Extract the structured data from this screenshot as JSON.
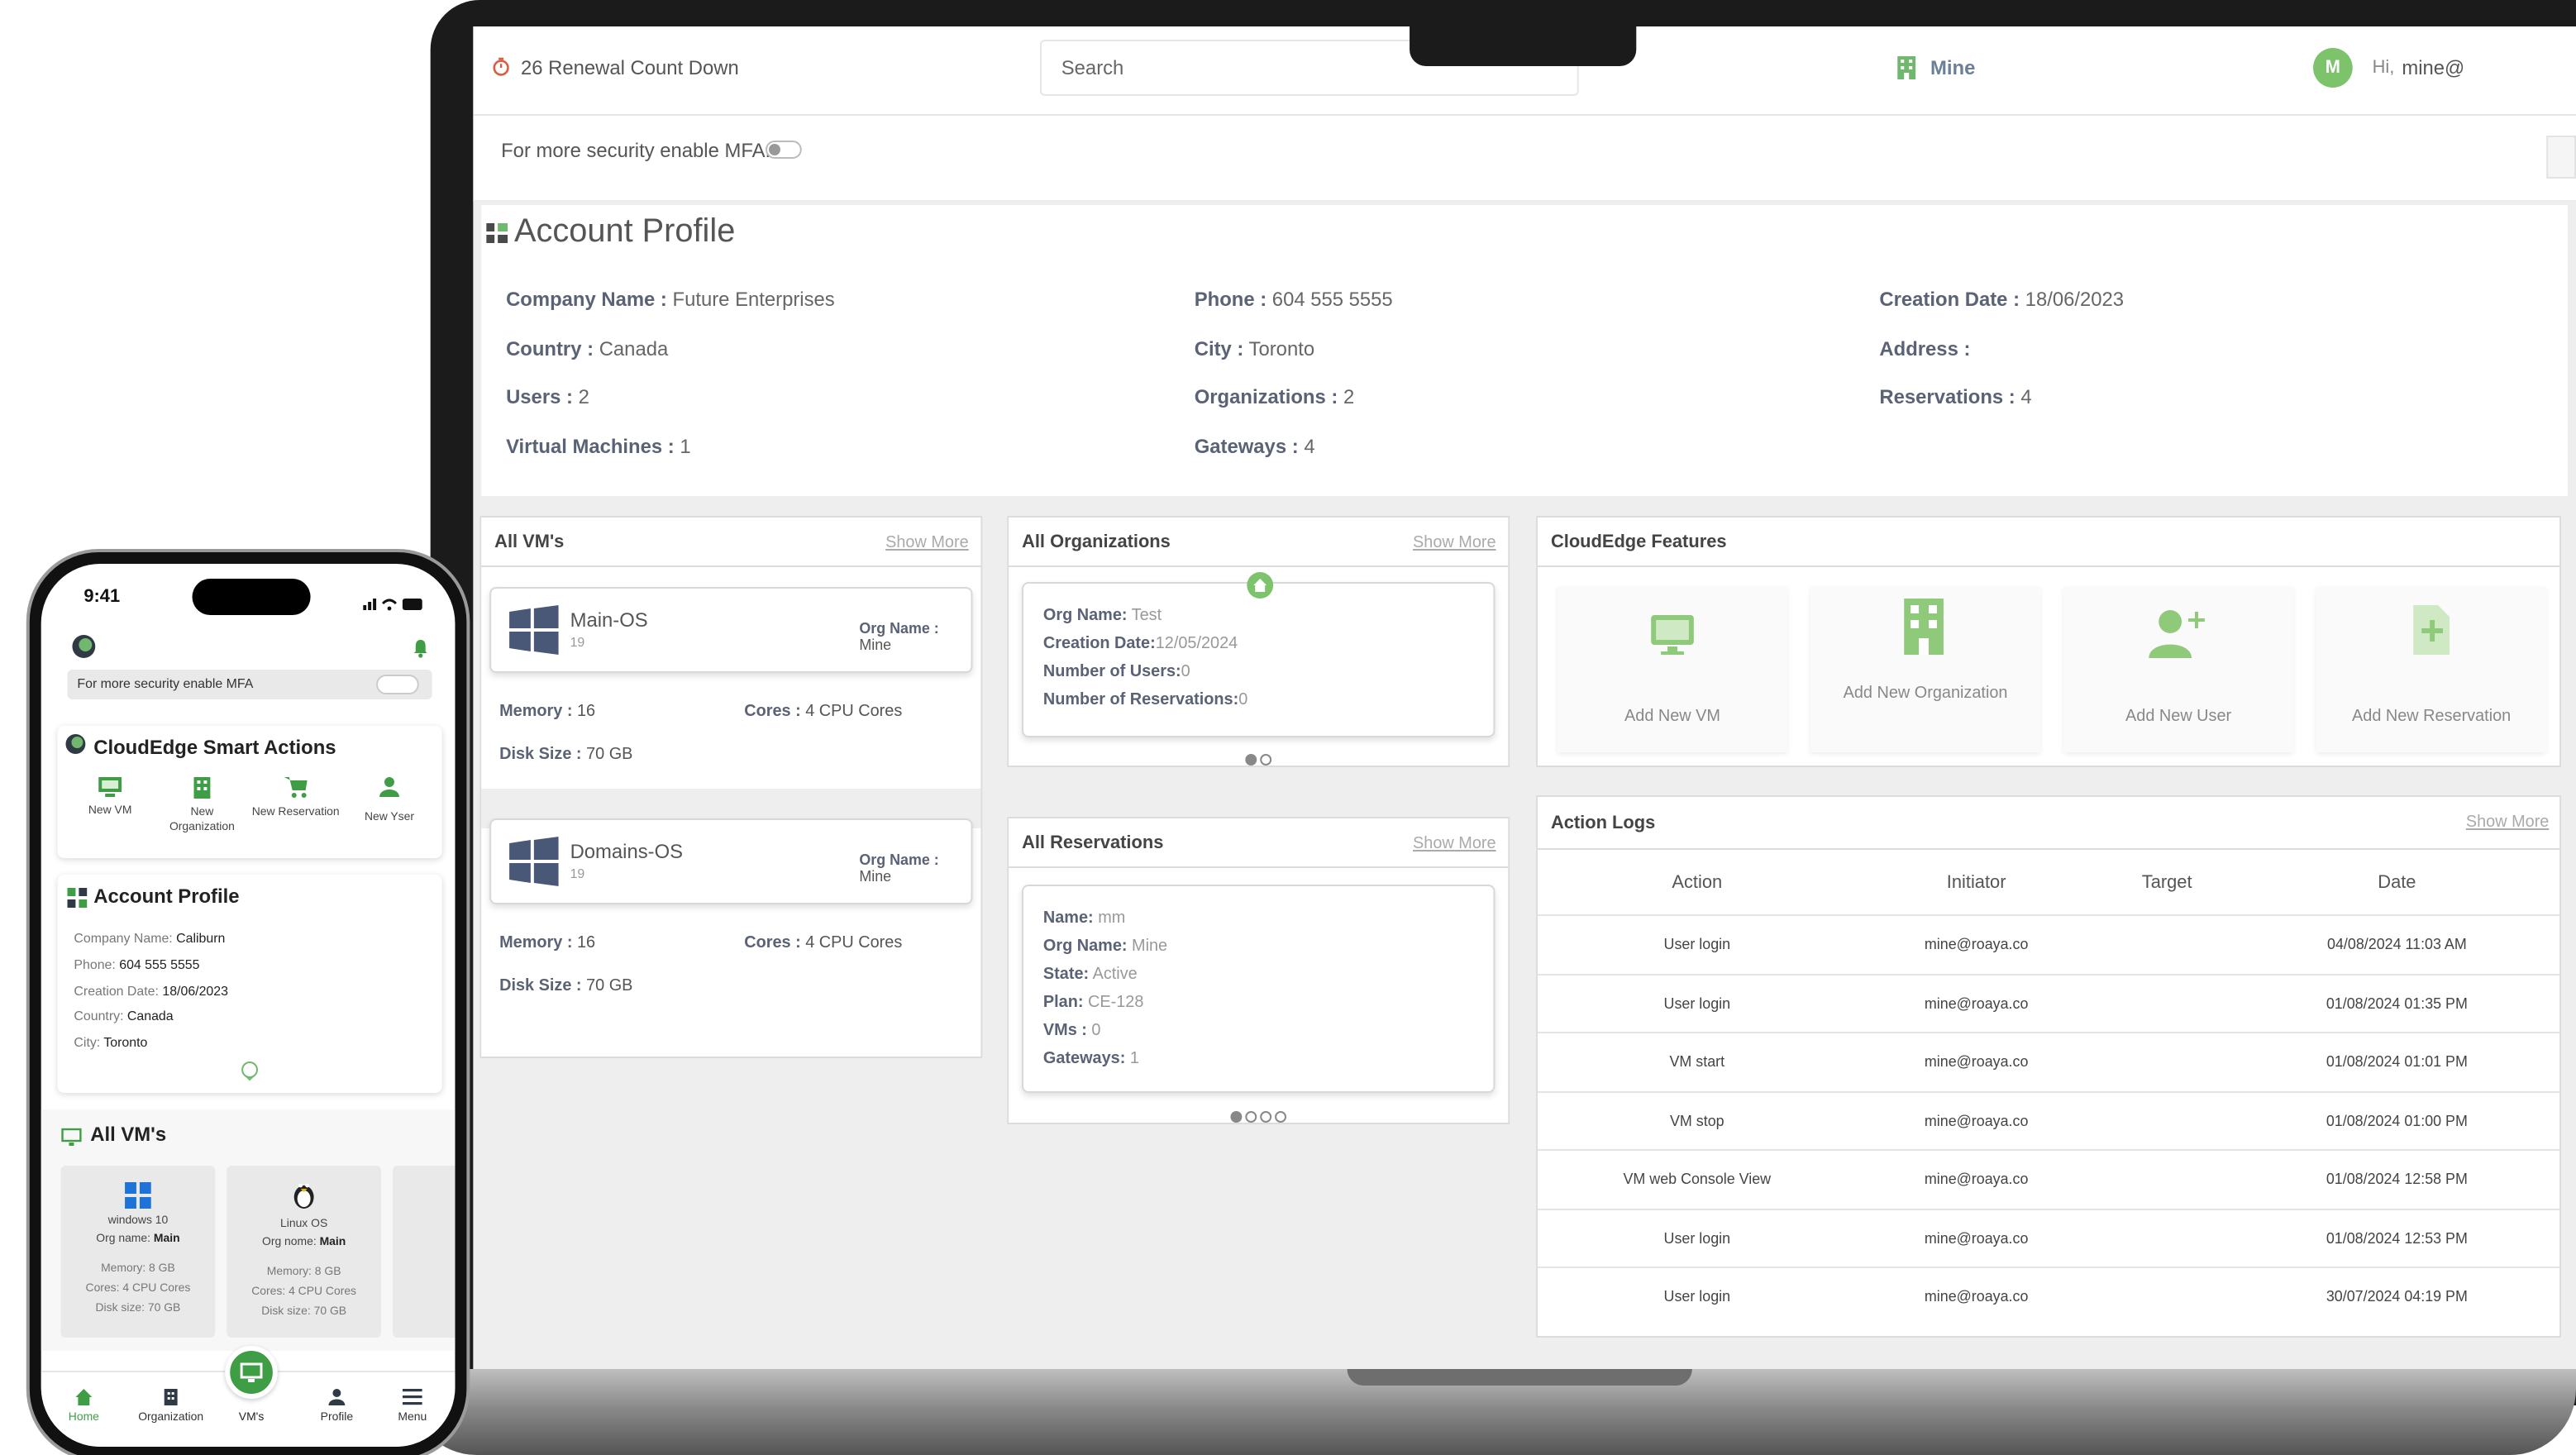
{
  "colors": {
    "brand_green": "#3f9d46",
    "accent_green": "#6fb86e",
    "frame": "#1b1b1b"
  },
  "laptop": {
    "topbar": {
      "renewal": "26 Renewal Count Down",
      "search_placeholder": "Search",
      "org": "Mine",
      "avatar_letter": "M",
      "greeting": "Hi,",
      "user": "mine@"
    },
    "mfa_label": "For more security enable MFA:",
    "profile": {
      "title": "Account Profile",
      "fields": [
        {
          "label": "Company Name :",
          "value": "Future Enterprises"
        },
        {
          "label": "Country :",
          "value": "Canada"
        },
        {
          "label": "Users :",
          "value": "2"
        },
        {
          "label": "Virtual Machines :",
          "value": "1"
        },
        {
          "label": "Phone :",
          "value": "604 555 5555"
        },
        {
          "label": "City :",
          "value": "Toronto"
        },
        {
          "label": "Organizations :",
          "value": "2"
        },
        {
          "label": "Gateways :",
          "value": "4"
        },
        {
          "label": "Creation Date :",
          "value": "18/06/2023"
        },
        {
          "label": "Address :",
          "value": ""
        },
        {
          "label": "Reservations :",
          "value": "4"
        }
      ]
    },
    "vms": {
      "title": "All VM's",
      "show_more": "Show More",
      "items": [
        {
          "name": "Main-OS",
          "sub": "19",
          "org_label": "Org Name :",
          "org": "Mine",
          "memory_label": "Memory :",
          "memory": "16",
          "cores_label": "Cores :",
          "cores": "4 CPU Cores",
          "disk_label": "Disk Size :",
          "disk": "70 GB"
        },
        {
          "name": "Domains-OS",
          "sub": "19",
          "org_label": "Org Name :",
          "org": "Mine",
          "memory_label": "Memory :",
          "memory": "16",
          "cores_label": "Cores :",
          "cores": "4 CPU Cores",
          "disk_label": "Disk Size :",
          "disk": "70 GB"
        }
      ]
    },
    "orgs": {
      "title": "All Organizations",
      "show_more": "Show More",
      "lines": [
        {
          "label": "Org Name:",
          "value": " Test"
        },
        {
          "label": "Creation Date:",
          "value": "12/05/2024"
        },
        {
          "label": "Number of Users:",
          "value": "0"
        },
        {
          "label": "Number of Reservations:",
          "value": "0"
        }
      ]
    },
    "reservations": {
      "title": "All Reservations",
      "show_more": "Show More",
      "lines": [
        {
          "label": "Name:",
          "value": " mm"
        },
        {
          "label": "Org Name:",
          "value": " Mine"
        },
        {
          "label": "State:",
          "value": " Active"
        },
        {
          "label": "Plan:",
          "value": " CE-128"
        },
        {
          "label": "VMs :",
          "value": " 0"
        },
        {
          "label": "Gateways:",
          "value": " 1"
        }
      ]
    },
    "features": {
      "title": "CloudEdge Features",
      "items": [
        {
          "label": "Add New VM"
        },
        {
          "label": "Add New Organization"
        },
        {
          "label": "Add New User"
        },
        {
          "label": "Add New Reservation"
        }
      ]
    },
    "logs": {
      "title": "Action Logs",
      "show_more": "Show More",
      "headers": [
        "Action",
        "Initiator",
        "Target",
        "Date"
      ],
      "rows": [
        [
          "User login",
          "mine@roaya.co",
          "",
          "04/08/2024 11:03 AM"
        ],
        [
          "User login",
          "mine@roaya.co",
          "",
          "01/08/2024 01:35 PM"
        ],
        [
          "VM start",
          "mine@roaya.co",
          "",
          "01/08/2024 01:01 PM"
        ],
        [
          "VM stop",
          "mine@roaya.co",
          "",
          "01/08/2024 01:00 PM"
        ],
        [
          "VM web Console View",
          "mine@roaya.co",
          "",
          "01/08/2024 12:58 PM"
        ],
        [
          "User login",
          "mine@roaya.co",
          "",
          "01/08/2024 12:53 PM"
        ],
        [
          "User login",
          "mine@roaya.co",
          "",
          "30/07/2024 04:19 PM"
        ]
      ]
    }
  },
  "phone": {
    "time": "9:41",
    "mfa_label": "For more security enable MFA",
    "smart_title": "CloudEdge Smart Actions",
    "actions": [
      {
        "label": "New VM"
      },
      {
        "label": "New Organization"
      },
      {
        "label": "New Reservation"
      },
      {
        "label": "New Yser"
      }
    ],
    "profile_title": "Account Profile",
    "profile_fields": [
      {
        "label": "Company Name:",
        "value": " Caliburn"
      },
      {
        "label": "Phone:",
        "value": " 604 555 5555"
      },
      {
        "label": "Creation Date:",
        "value": " 18/06/2023"
      },
      {
        "label": "Country:",
        "value": " Canada"
      },
      {
        "label": "City:",
        "value": " Toronto"
      }
    ],
    "vms_title": "All VM's",
    "vms": [
      {
        "name": "windows 10",
        "org_label": "Org name:",
        "org": " Main",
        "memory": "Memory: 8 GB",
        "cores": "Cores: 4 CPU Cores",
        "disk": "Disk size: 70 GB"
      },
      {
        "name": "Linux OS",
        "org_label": "Org nome:",
        "org": " Main",
        "memory": "Memory: 8 GB",
        "cores": "Cores: 4 CPU Cores",
        "disk": "Disk size: 70 GB"
      }
    ],
    "nav": [
      {
        "label": "Home"
      },
      {
        "label": "Organization"
      },
      {
        "label": "VM's"
      },
      {
        "label": "Profile"
      },
      {
        "label": "Menu"
      }
    ]
  }
}
